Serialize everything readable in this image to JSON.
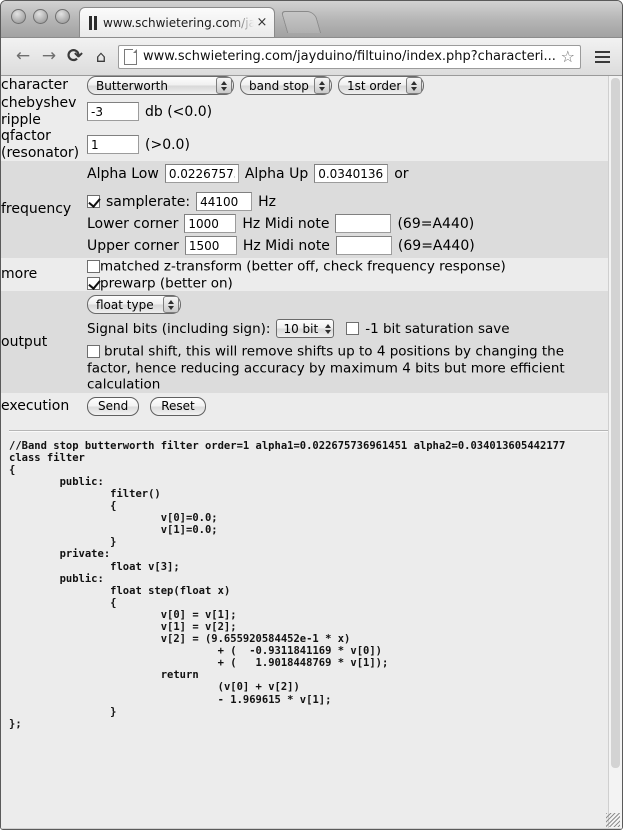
{
  "browser": {
    "tab": {
      "title": "www.schwietering.com/jay",
      "close_label": "×"
    },
    "nav": {
      "back": "←",
      "forward": "→",
      "reload": "⟳",
      "home": "⌂"
    },
    "address": {
      "url": "www.schwietering.com/jayduino/filtuino/index.php?characteri...",
      "star": "☆"
    }
  },
  "form": {
    "rows": {
      "character": {
        "label": "character",
        "type_select": "Butterworth",
        "band_select": "band stop",
        "order_select": "1st order"
      },
      "chebyshev": {
        "label_line1": "chebyshev",
        "label_line2": "ripple",
        "ripple_value": "-3",
        "unit_text": "db (<0.0)"
      },
      "qfactor": {
        "label_line1": "qfactor",
        "label_line2": "(resonator)",
        "q_value": "1",
        "hint_text": "(>0.0)"
      },
      "frequency": {
        "label": "frequency",
        "alpha_low_label": "Alpha Low",
        "alpha_low_value": "0.02267573",
        "alpha_up_label": "Alpha Up",
        "alpha_up_value": "0.03401360",
        "or_text": "or",
        "samplerate_label": "samplerate:",
        "samplerate_value": "44100",
        "hz_text": "Hz",
        "lower_label": "Lower corner",
        "lower_value": "1000",
        "upper_label": "Upper corner",
        "upper_value": "1500",
        "midi_label": "Hz Midi note",
        "midi_lower_value": "",
        "midi_upper_value": "",
        "a440_text": "(69=A440)"
      },
      "more": {
        "label": "more",
        "matched_label": "matched z-transform (better off, check frequency response)",
        "prewarp_label": "prewarp (better on)"
      },
      "output": {
        "label": "output",
        "float_select": "float type",
        "signal_bits_label": "Signal bits (including sign):",
        "bits_select": "10 bit",
        "saturation_label": "-1 bit saturation save",
        "brutal_label": "brutal shift, this will remove shifts up to 4 positions by changing the factor, hence reducing accuracy by maximum 4 bits but more efficient calculation"
      },
      "execution": {
        "label": "execution",
        "send_label": "Send",
        "reset_label": "Reset"
      }
    }
  },
  "code": {
    "text": "//Band stop butterworth filter order=1 alpha1=0.022675736961451 alpha2=0.034013605442177\nclass filter\n{\n\tpublic:\n\t\tfilter()\n\t\t{\n\t\t\tv[0]=0.0;\n\t\t\tv[1]=0.0;\n\t\t}\n\tprivate:\n\t\tfloat v[3];\n\tpublic:\n\t\tfloat step(float x)\n\t\t{\n\t\t\tv[0] = v[1];\n\t\t\tv[1] = v[2];\n\t\t\tv[2] = (9.655920584452e-1 * x)\n\t\t\t\t + (  -0.9311841169 * v[0])\n\t\t\t\t + (   1.9018448769 * v[1]);\n\t\t\treturn\n\t\t\t\t (v[0] + v[2])\n\t\t\t\t - 1.969615 * v[1];\n\t\t}\n};"
  },
  "colors": {
    "page_bg": "#ececec",
    "shade_bg": "#dcdcdc",
    "text": "#000000"
  }
}
